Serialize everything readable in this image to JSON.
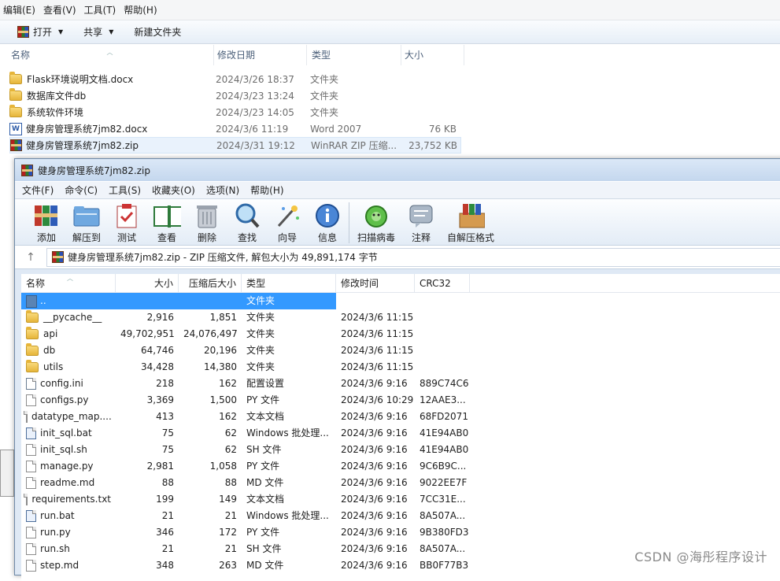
{
  "explorer": {
    "menu": [
      "编辑(E)",
      "查看(V)",
      "工具(T)",
      "帮助(H)"
    ],
    "toolbar": {
      "open": "打开",
      "share": "共享",
      "new_folder": "新建文件夹"
    },
    "columns": [
      "名称",
      "修改日期",
      "类型",
      "大小"
    ],
    "rows": [
      {
        "name": "Flask环境说明文档.docx",
        "date": "2024/3/26 18:37",
        "type": "文件夹",
        "size": "",
        "icon": "folder-icon"
      },
      {
        "name": "数据库文件db",
        "date": "2024/3/23 13:24",
        "type": "文件夹",
        "size": "",
        "icon": "folder-icon"
      },
      {
        "name": "系统软件环境",
        "date": "2024/3/23 14:05",
        "type": "文件夹",
        "size": "",
        "icon": "folder-icon"
      },
      {
        "name": "健身房管理系统7jm82.docx",
        "date": "2024/3/6 11:19",
        "type": "Word 2007",
        "size": "76 KB",
        "icon": "word-icon"
      },
      {
        "name": "健身房管理系统7jm82.zip",
        "date": "2024/3/31 19:12",
        "type": "WinRAR ZIP 压缩...",
        "size": "23,752 KB",
        "icon": "rar-icon"
      }
    ]
  },
  "winrar": {
    "title": "健身房管理系统7jm82.zip",
    "menu": [
      "文件(F)",
      "命令(C)",
      "工具(S)",
      "收藏夹(O)",
      "选项(N)",
      "帮助(H)"
    ],
    "tools": [
      "添加",
      "解压到",
      "测试",
      "查看",
      "删除",
      "查找",
      "向导",
      "信息",
      "扫描病毒",
      "注释",
      "自解压格式"
    ],
    "path": "健身房管理系统7jm82.zip - ZIP 压缩文件, 解包大小为 49,891,174 字节",
    "columns": [
      "名称",
      "大小",
      "压缩后大小",
      "类型",
      "修改时间",
      "CRC32"
    ],
    "rows": [
      {
        "name": "..",
        "size": "",
        "packed": "",
        "type": "文件夹",
        "time": "",
        "crc": "",
        "icon": "up-folder"
      },
      {
        "name": "__pycache__",
        "size": "2,916",
        "packed": "1,851",
        "type": "文件夹",
        "time": "2024/3/6 11:15",
        "crc": "",
        "icon": "folder"
      },
      {
        "name": "api",
        "size": "49,702,951",
        "packed": "24,076,497",
        "type": "文件夹",
        "time": "2024/3/6 11:15",
        "crc": "",
        "icon": "folder"
      },
      {
        "name": "db",
        "size": "64,746",
        "packed": "20,196",
        "type": "文件夹",
        "time": "2024/3/6 11:15",
        "crc": "",
        "icon": "folder"
      },
      {
        "name": "utils",
        "size": "34,428",
        "packed": "14,380",
        "type": "文件夹",
        "time": "2024/3/6 11:15",
        "crc": "",
        "icon": "folder"
      },
      {
        "name": "config.ini",
        "size": "218",
        "packed": "162",
        "type": "配置设置",
        "time": "2024/3/6 9:16",
        "crc": "889C74C6",
        "icon": "gear"
      },
      {
        "name": "configs.py",
        "size": "3,369",
        "packed": "1,500",
        "type": "PY 文件",
        "time": "2024/3/6 10:29",
        "crc": "12AAE3...",
        "icon": "file"
      },
      {
        "name": "datatype_map....",
        "size": "413",
        "packed": "162",
        "type": "文本文档",
        "time": "2024/3/6 9:16",
        "crc": "68FD2071",
        "icon": "file"
      },
      {
        "name": "init_sql.bat",
        "size": "75",
        "packed": "62",
        "type": "Windows 批处理...",
        "time": "2024/3/6 9:16",
        "crc": "41E94AB0",
        "icon": "bat"
      },
      {
        "name": "init_sql.sh",
        "size": "75",
        "packed": "62",
        "type": "SH 文件",
        "time": "2024/3/6 9:16",
        "crc": "41E94AB0",
        "icon": "file"
      },
      {
        "name": "manage.py",
        "size": "2,981",
        "packed": "1,058",
        "type": "PY 文件",
        "time": "2024/3/6 9:16",
        "crc": "9C6B9C...",
        "icon": "file"
      },
      {
        "name": "readme.md",
        "size": "88",
        "packed": "88",
        "type": "MD 文件",
        "time": "2024/3/6 9:16",
        "crc": "9022EE7F",
        "icon": "file"
      },
      {
        "name": "requirements.txt",
        "size": "199",
        "packed": "149",
        "type": "文本文档",
        "time": "2024/3/6 9:16",
        "crc": "7CC31E...",
        "icon": "file"
      },
      {
        "name": "run.bat",
        "size": "21",
        "packed": "21",
        "type": "Windows 批处理...",
        "time": "2024/3/6 9:16",
        "crc": "8A507A...",
        "icon": "bat"
      },
      {
        "name": "run.py",
        "size": "346",
        "packed": "172",
        "type": "PY 文件",
        "time": "2024/3/6 9:16",
        "crc": "9B380FD3",
        "icon": "file"
      },
      {
        "name": "run.sh",
        "size": "21",
        "packed": "21",
        "type": "SH 文件",
        "time": "2024/3/6 9:16",
        "crc": "8A507A...",
        "icon": "file"
      },
      {
        "name": "step.md",
        "size": "348",
        "packed": "263",
        "type": "MD 文件",
        "time": "2024/3/6 9:16",
        "crc": "BB0F77B3",
        "icon": "file"
      }
    ]
  },
  "watermark": "CSDN @海彤程序设计"
}
